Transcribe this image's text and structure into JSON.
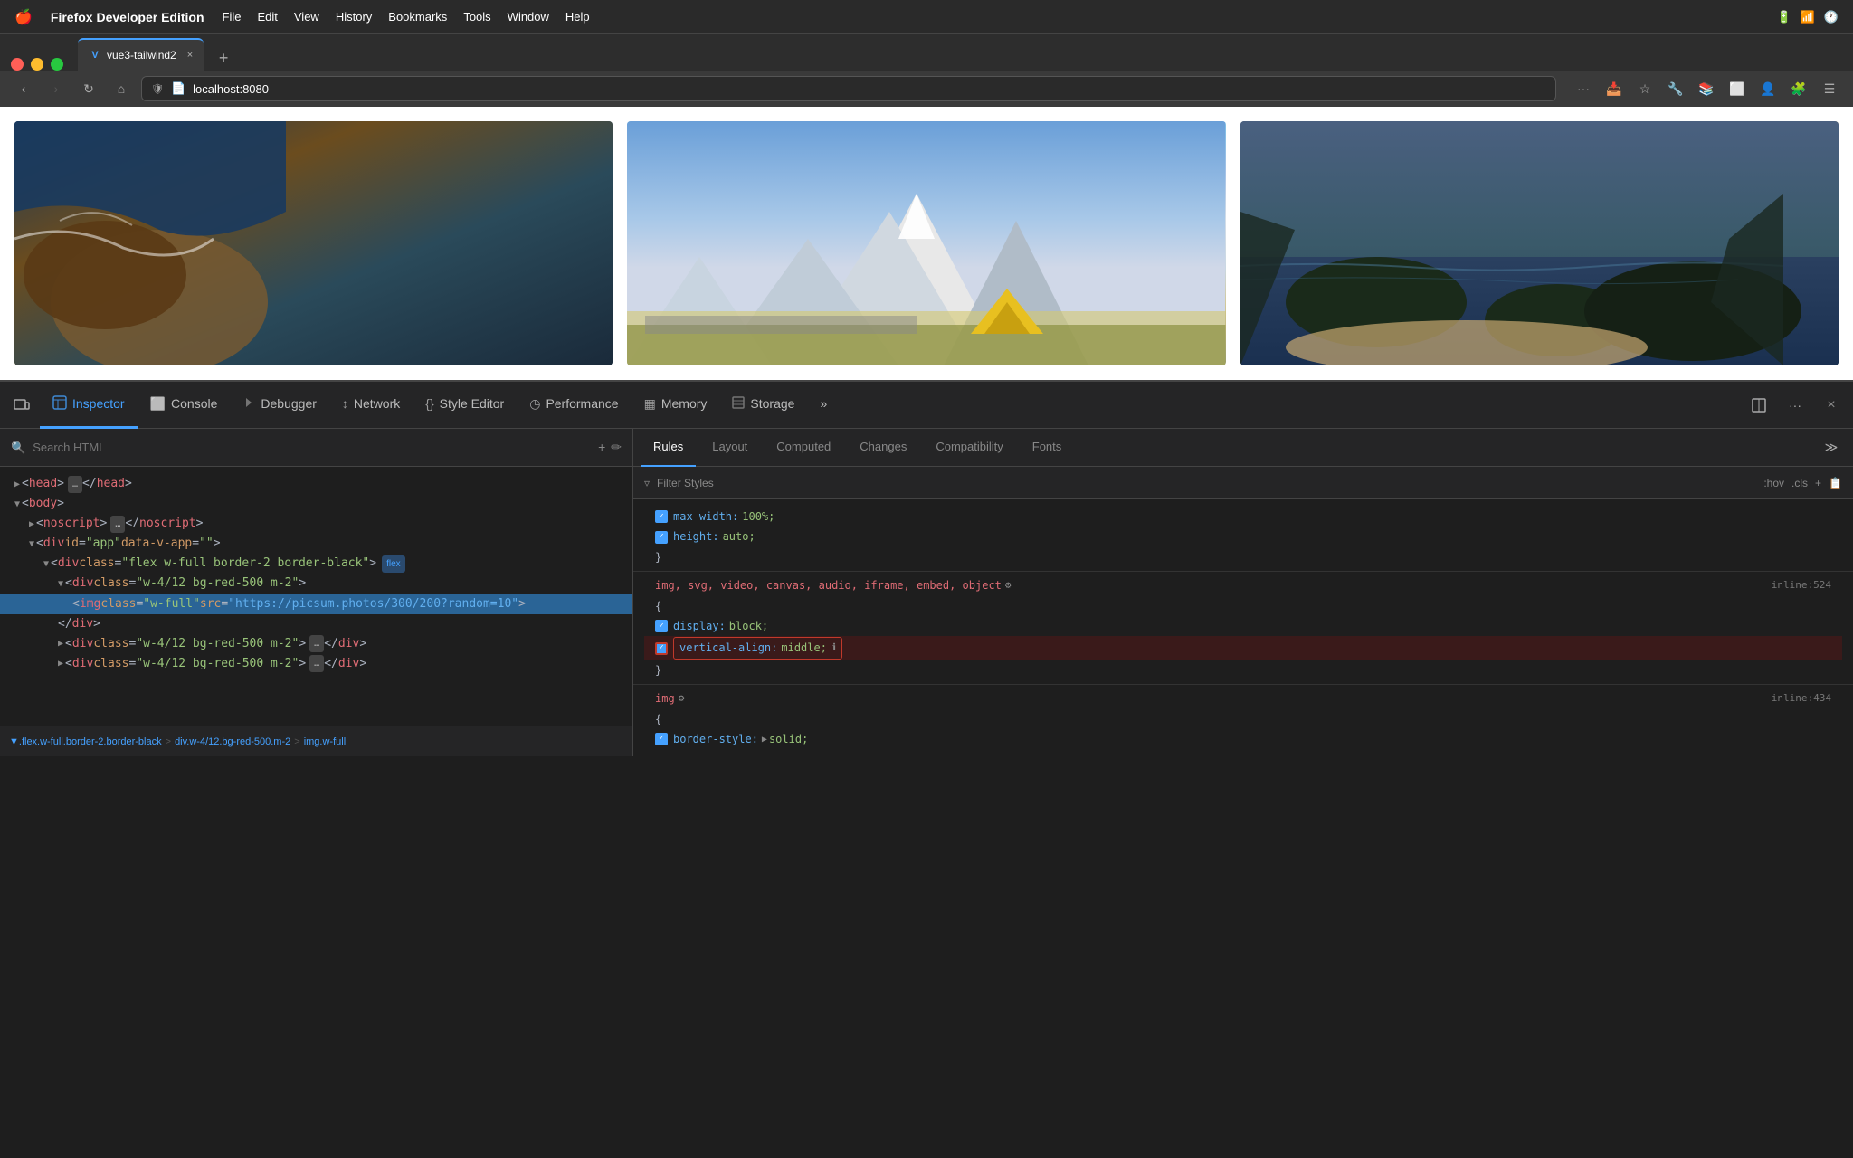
{
  "menubar": {
    "apple": "🍎",
    "app_name": "Firefox Developer Edition",
    "menus": [
      "File",
      "Edit",
      "View",
      "History",
      "Bookmarks",
      "Tools",
      "Window",
      "Help"
    ]
  },
  "browser": {
    "tab": {
      "label": "vue3-tailwind2",
      "favicon": "V",
      "close": "×"
    },
    "url": "localhost:8080",
    "url_shield": "🛡",
    "url_page": "📄"
  },
  "devtools": {
    "tools": [
      {
        "label": "Inspector",
        "icon": "⬡",
        "active": true
      },
      {
        "label": "Console",
        "icon": "⬜",
        "active": false
      },
      {
        "label": "Debugger",
        "icon": "⬡",
        "active": false
      },
      {
        "label": "Network",
        "icon": "↕",
        "active": false
      },
      {
        "label": "Style Editor",
        "icon": "{}",
        "active": false
      },
      {
        "label": "Performance",
        "icon": "◷",
        "active": false
      },
      {
        "label": "Memory",
        "icon": "▦",
        "active": false
      },
      {
        "label": "Storage",
        "icon": "📋",
        "active": false
      }
    ],
    "html_panel": {
      "search_placeholder": "Search HTML",
      "tree": [
        {
          "indent": 0,
          "content": "▶ <head>…</head>",
          "type": "collapsed"
        },
        {
          "indent": 0,
          "content": "▼ <body>",
          "type": "tag"
        },
        {
          "indent": 1,
          "content": "▶ <noscript>…</noscript>",
          "type": "collapsed"
        },
        {
          "indent": 1,
          "content": "▼ <div id=\"app\" data-v-app=\"\">",
          "type": "tag"
        },
        {
          "indent": 2,
          "content": "▼ <div class=\"flex w-full border-2 border-black\">",
          "type": "tag",
          "badge": "flex"
        },
        {
          "indent": 3,
          "content": "▼ <div class=\"w-4/12 bg-red-500 m-2\">",
          "type": "tag"
        },
        {
          "indent": 4,
          "content": "<img class=\"w-full\" src=\"https://picsum.photos/300/200?random=10\">",
          "type": "selected"
        },
        {
          "indent": 3,
          "content": "</div>",
          "type": "close"
        },
        {
          "indent": 3,
          "content": "▶ <div class=\"w-4/12 bg-red-500 m-2\">…</div>",
          "type": "collapsed"
        },
        {
          "indent": 3,
          "content": "▶ <div class=\"w-4/12 bg-red-500 m-2\">…</div>",
          "type": "collapsed"
        }
      ],
      "breadcrumb": "▼.flex.w-full.border-2.border-black > div.w-4/12.bg-red-500.m-2 > img.w-full"
    },
    "css_panel": {
      "tabs": [
        "Rules",
        "Layout",
        "Computed",
        "Changes",
        "Compatibility",
        "Fonts"
      ],
      "active_tab": "Rules",
      "filter_placeholder": "Filter Styles",
      "pseudo_buttons": [
        ":hov",
        ".cls"
      ],
      "rules": [
        {
          "selector": "",
          "properties": [
            {
              "prop": "max-width:",
              "val": "100%;",
              "enabled": true,
              "strikethrough": false
            },
            {
              "prop": "height:",
              "val": "auto;",
              "enabled": true,
              "strikethrough": false
            }
          ],
          "source": ""
        },
        {
          "selector": "img, svg, video, canvas, audio, iframe, embed, object",
          "settings_icon": true,
          "properties": [
            {
              "prop": "display:",
              "val": "block;",
              "enabled": true,
              "strikethrough": false
            },
            {
              "prop": "vertical-align:",
              "val": "middle;",
              "enabled": true,
              "strikethrough": false,
              "highlighted": true,
              "info": true
            }
          ],
          "source": "inline:524"
        },
        {
          "selector": "img",
          "settings_icon": true,
          "properties": [
            {
              "prop": "border-style:",
              "val": "▶ solid;",
              "enabled": true,
              "strikethrough": false
            }
          ],
          "source": "inline:434"
        }
      ]
    }
  }
}
